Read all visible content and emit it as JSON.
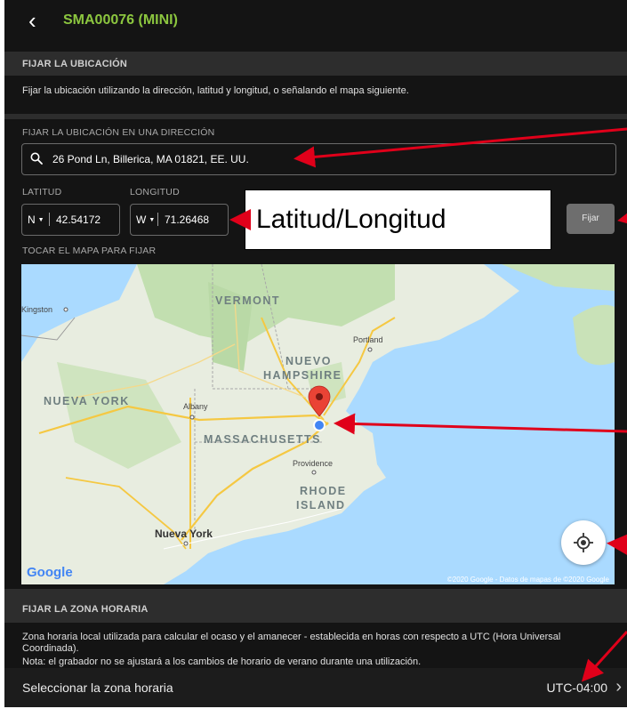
{
  "header": {
    "back_glyph": "‹",
    "title": "SMA00076 (MINI)",
    "accent": "#8cc63f"
  },
  "location": {
    "section_title": "FIJAR LA UBICACIÓN",
    "description": "Fijar la ubicación utilizando la dirección, latitud y longitud, o señalando el mapa siguiente.",
    "address_label": "FIJAR LA UBICACIÓN EN UNA DIRECCIÓN",
    "address_value": "26 Pond Ln, Billerica, MA 01821, EE. UU.",
    "latitude_label": "LATITUD",
    "longitude_label": "LONGITUD",
    "latitude_hemisphere": "N",
    "latitude_value": "42.54172",
    "longitude_hemisphere": "W",
    "longitude_value": "71.26468",
    "set_button": "Fijar",
    "map_label": "TOCAR EL MAPA PARA FIJAR"
  },
  "callout": {
    "text": "Latitud/Longitud"
  },
  "map": {
    "labels": {
      "vermont": "VERMONT",
      "kingston": "Kingston",
      "portland": "Portland",
      "nuevo": "NUEVO",
      "hampshire": "HAMPSHIRE",
      "nueva_york_state": "NUEVA YORK",
      "albany": "Albany",
      "massachusetts": "MASSACHUSETTS",
      "providence": "Providence",
      "rhode": "RHODE",
      "island": "ISLAND",
      "nueva_york_city": "Nueva York"
    },
    "logo": "Google",
    "attribution": "©2020 Google - Datos de mapas de ©2020 Google",
    "colors": {
      "water": "#aadaff",
      "land": "#e8ede0",
      "forest": "#c2dfb0",
      "pin": "#ea4335",
      "dot": "#4285f4"
    }
  },
  "timezone": {
    "section_title": "FIJAR LA ZONA HORARIA",
    "description_1": "Zona horaria local utilizada para calcular el ocaso y el amanecer - establecida en horas con respecto a UTC (Hora Universal Coordinada).",
    "description_2": "Nota: el grabador no se ajustará a los cambios de horario de verano durante una utilización.",
    "select_label": "Seleccionar la zona horaria",
    "select_value": "UTC-04:00"
  },
  "annotation_color": "#e0001a"
}
